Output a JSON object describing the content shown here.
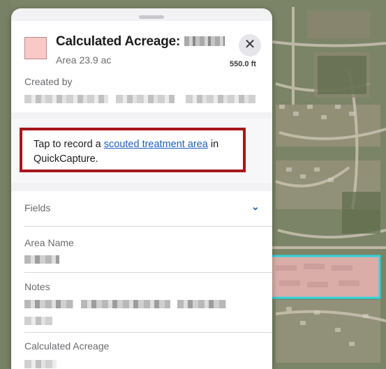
{
  "header": {
    "title": "Calculated Acreage:",
    "subtitle": "Area 23.9 ac",
    "close_icon": "close-icon",
    "scale_text": "550.0 ft",
    "swatch_color": "#f9c9c7"
  },
  "created_by": {
    "label": "Created by"
  },
  "callout": {
    "text_before": "Tap to record a ",
    "link_text": "scouted treatment area",
    "text_after": " in QuickCapture.",
    "border_color": "#a8161c"
  },
  "fields": {
    "header_label": "Fields",
    "chevron_icon": "chevron-down-icon",
    "items": [
      {
        "label": "Area Name"
      },
      {
        "label": "Notes"
      },
      {
        "label": "Calculated Acreage"
      }
    ]
  },
  "map": {
    "highlight_color": "#2fd4dc"
  }
}
